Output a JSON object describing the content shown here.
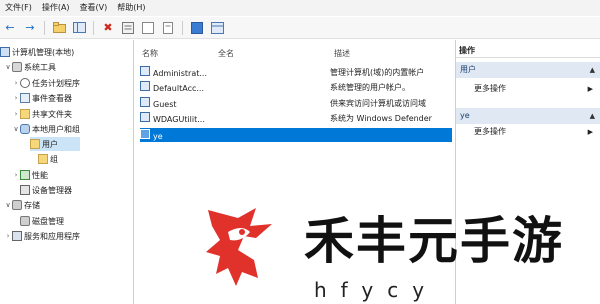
{
  "menu": {
    "file": "文件(F)",
    "action": "操作(A)",
    "view": "查看(V)",
    "help": "帮助(H)"
  },
  "toolbar": {
    "icons": [
      "back-arrow",
      "forward-arrow",
      "up-folder",
      "show-hide-tree",
      "delete",
      "properties",
      "refresh",
      "export",
      "help",
      "split-view"
    ]
  },
  "tree": {
    "root": "计算机管理(本地)",
    "system_tools": "系统工具",
    "task_scheduler": "任务计划程序",
    "event_viewer": "事件查看器",
    "shared_folders": "共享文件夹",
    "local_users_groups": "本地用户和组",
    "users": "用户",
    "groups": "组",
    "performance": "性能",
    "device_manager": "设备管理器",
    "storage": "存储",
    "disk_management": "磁盘管理",
    "services_apps": "服务和应用程序"
  },
  "list": {
    "headers": {
      "name": "名称",
      "fullname": "全名",
      "description": "描述"
    },
    "rows": [
      {
        "name": "Administrat...",
        "fullname": "",
        "description": "管理计算机(域)的内置帐户"
      },
      {
        "name": "DefaultAcc...",
        "fullname": "",
        "description": "系统管理的用户帐户。"
      },
      {
        "name": "Guest",
        "fullname": "",
        "description": "供来宾访问计算机或访问域"
      },
      {
        "name": "WDAGUtilit...",
        "fullname": "",
        "description": "系统为 Windows Defender"
      },
      {
        "name": "ye",
        "fullname": "",
        "description": ""
      }
    ]
  },
  "actions": {
    "title": "操作",
    "section1": "用户",
    "section1_more": "更多操作",
    "section2": "ye",
    "section2_more": "更多操作"
  },
  "watermark": {
    "brand": "禾丰元手游",
    "pinyin": "hfycy"
  },
  "colors": {
    "selection": "#0078d7",
    "tree_selection": "#cce4f7",
    "action_header": "#dfe8f3",
    "watermark_red": "#e0312b"
  }
}
